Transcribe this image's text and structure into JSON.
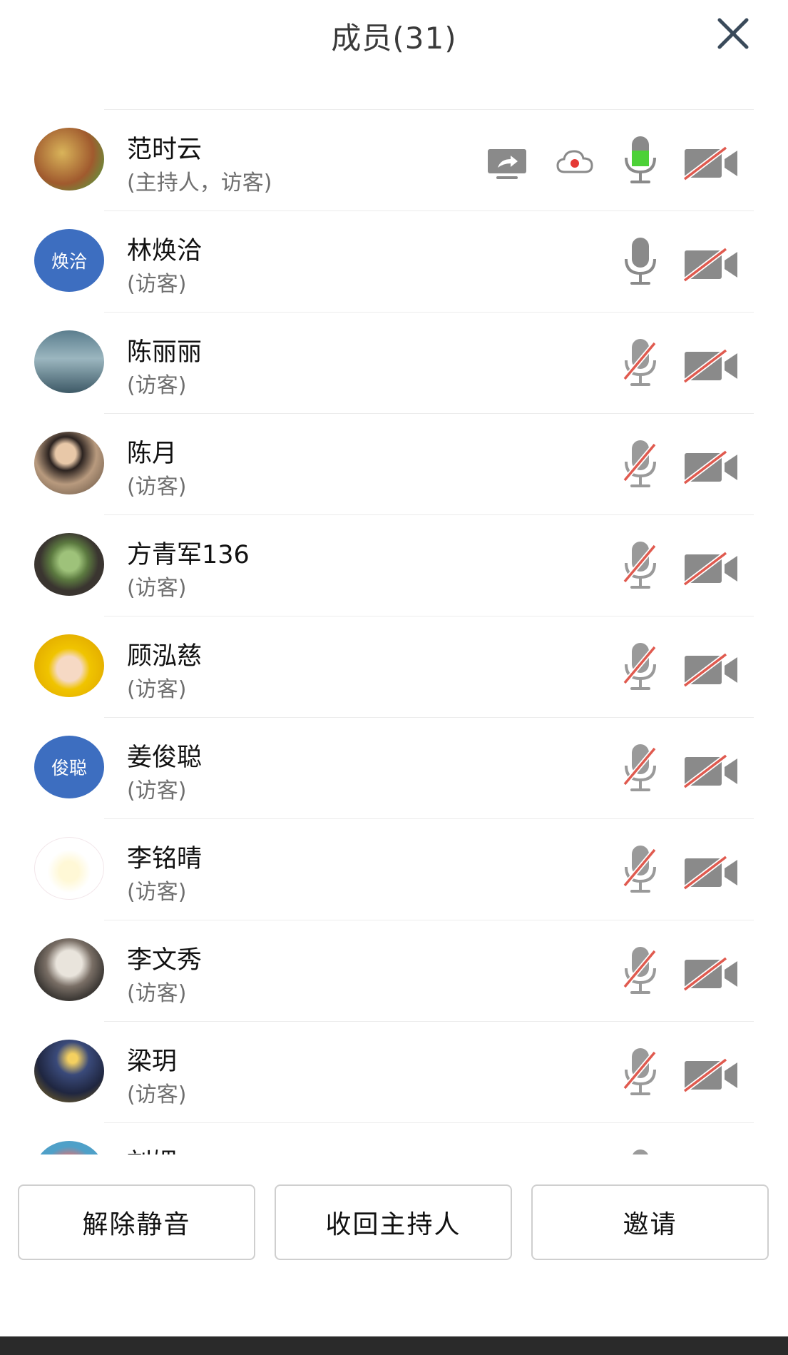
{
  "header": {
    "title": "成员(31)"
  },
  "members": [
    {
      "name": "范时云",
      "role": "(主持人，访客)",
      "avatar_text": "",
      "mic": "on-active",
      "camera": "off",
      "share": true,
      "recording": true
    },
    {
      "name": "林焕洽",
      "role": "(访客)",
      "avatar_text": "焕洽",
      "mic": "on",
      "camera": "off"
    },
    {
      "name": "陈丽丽",
      "role": "(访客)",
      "avatar_text": "",
      "mic": "off",
      "camera": "off"
    },
    {
      "name": "陈月",
      "role": "(访客)",
      "avatar_text": "",
      "mic": "off",
      "camera": "off"
    },
    {
      "name": "方青军136",
      "role": "(访客)",
      "avatar_text": "",
      "mic": "off",
      "camera": "off"
    },
    {
      "name": "顾泓慈",
      "role": "(访客)",
      "avatar_text": "",
      "mic": "off",
      "camera": "off"
    },
    {
      "name": "姜俊聪",
      "role": "(访客)",
      "avatar_text": "俊聪",
      "mic": "off",
      "camera": "off"
    },
    {
      "name": "李铭晴",
      "role": "(访客)",
      "avatar_text": "",
      "mic": "off",
      "camera": "off"
    },
    {
      "name": "李文秀",
      "role": "(访客)",
      "avatar_text": "",
      "mic": "off",
      "camera": "off"
    },
    {
      "name": "梁玥",
      "role": "(访客)",
      "avatar_text": "",
      "mic": "off",
      "camera": "off"
    },
    {
      "name": "刘媚",
      "role": "",
      "avatar_text": "",
      "mic": "off",
      "camera": "off"
    }
  ],
  "buttons": {
    "unmute": "解除静音",
    "reclaim_host": "收回主持人",
    "invite": "邀请"
  },
  "icons": {
    "close": "close-icon",
    "share": "screen-share-icon",
    "cloud": "cloud-record-icon",
    "mic_on": "microphone-icon",
    "mic_off": "microphone-muted-icon",
    "camera_off": "camera-off-icon"
  },
  "colors": {
    "avatar_blue": "#3d6ec0",
    "mic_active": "#4cd137",
    "record_red": "#e53935",
    "muted_red": "#e05a4f",
    "icon_gray": "#8a8a8a"
  }
}
